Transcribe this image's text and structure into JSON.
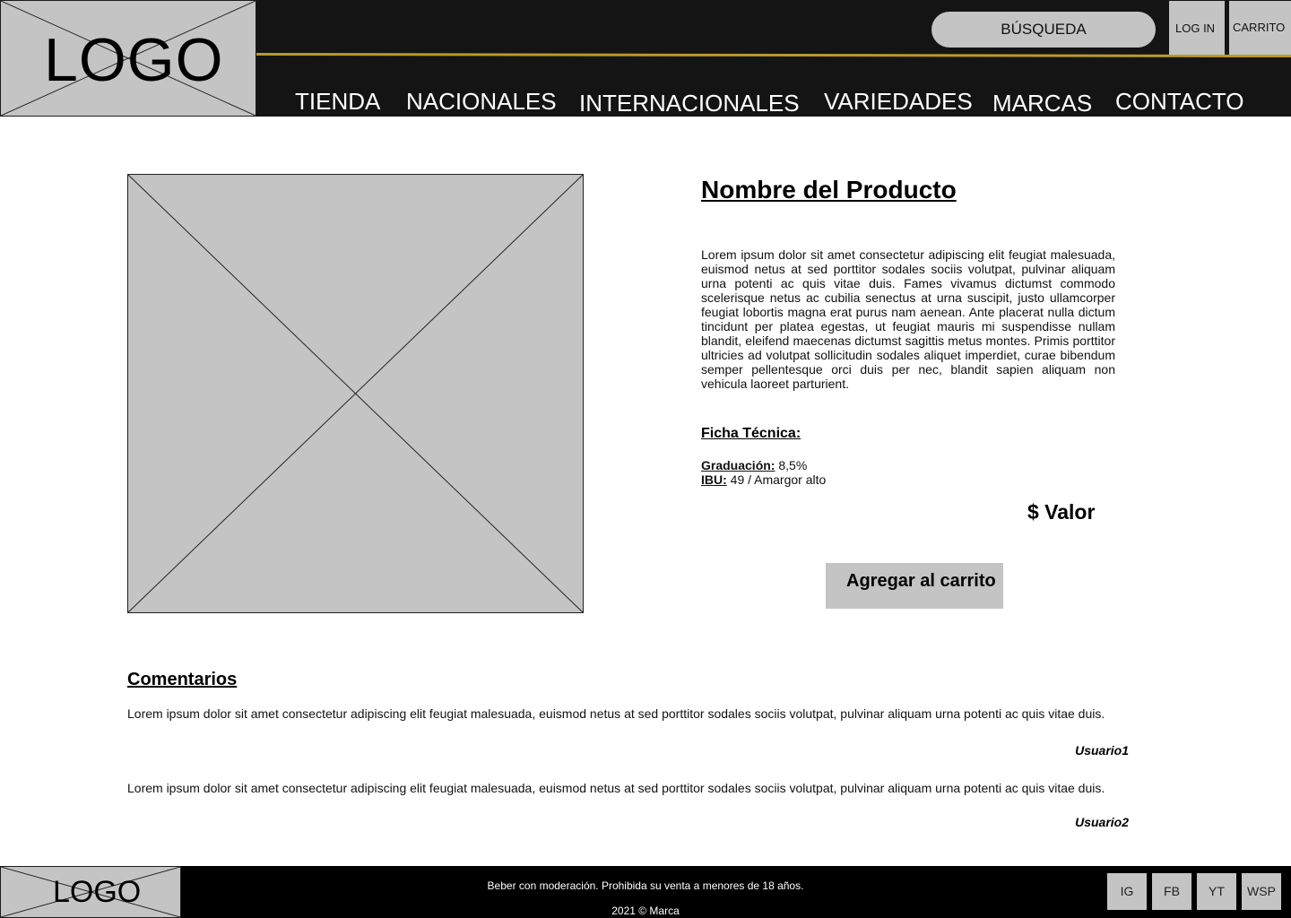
{
  "header": {
    "logo_text": "LOGO",
    "search_label": "BÚSQUEDA",
    "login_label": "LOG IN",
    "cart_label": "CARRITO",
    "accent_color": "#b99a29",
    "nav": [
      "TIENDA",
      "NACIONALES",
      "INTERNACIONALES",
      "VARIEDADES",
      "MARCAS",
      "CONTACTO"
    ]
  },
  "product": {
    "name": "Nombre del Producto",
    "description": "Lorem ipsum dolor sit amet consectetur adipiscing elit feugiat malesuada, euismod netus at sed porttitor sodales sociis volutpat, pulvinar aliquam urna potenti ac quis vitae duis. Fames vivamus dictumst commodo scelerisque netus ac cubilia senectus at urna suscipit, justo ullamcorper feugiat lobortis magna erat purus nam aenean. Ante placerat nulla dictum tincidunt per platea egestas, ut feugiat mauris mi suspendisse nullam blandit, eleifend maecenas dictumst sagittis metus montes. Primis porttitor ultricies ad volutpat sollicitudin sodales aliquet imperdiet, curae bibendum semper pellentesque orci duis per nec, blandit sapien aliquam non vehicula laoreet parturient.",
    "spec_title": "Ficha Técnica:",
    "specs": [
      {
        "label": "Graduación:",
        "value": "8,5%"
      },
      {
        "label": "IBU:",
        "value": "49 / Amargor alto"
      }
    ],
    "price": "$ Valor",
    "add_to_cart_label": "Agregar al carrito"
  },
  "comments": {
    "title": "Comentarios",
    "items": [
      {
        "text": "Lorem ipsum dolor sit amet consectetur adipiscing elit feugiat malesuada, euismod netus at sed porttitor sodales sociis volutpat, pulvinar aliquam urna potenti ac quis vitae duis.",
        "user": "Usuario1"
      },
      {
        "text": "Lorem ipsum dolor sit amet consectetur adipiscing elit feugiat malesuada, euismod netus at sed porttitor sodales sociis volutpat, pulvinar aliquam urna potenti ac quis vitae duis.",
        "user": "Usuario2"
      }
    ]
  },
  "footer": {
    "logo_text": "LOGO",
    "disclaimer": "Beber con moderación. Prohibida su venta a menores de 18 años.",
    "copyright": "2021 © Marca",
    "social": [
      "IG",
      "FB",
      "YT",
      "WSP"
    ]
  }
}
